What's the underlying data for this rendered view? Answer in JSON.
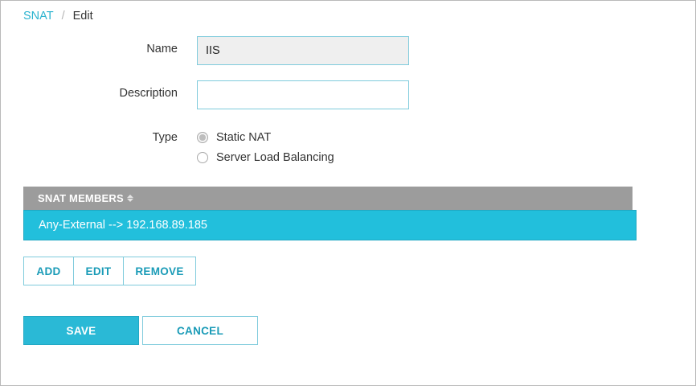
{
  "breadcrumb": {
    "parent": "SNAT",
    "separator": "/",
    "current": "Edit"
  },
  "form": {
    "name_label": "Name",
    "name_value": "IIS",
    "description_label": "Description",
    "description_value": "",
    "type_label": "Type",
    "type_options": [
      {
        "label": "Static NAT",
        "selected": true
      },
      {
        "label": "Server Load Balancing",
        "selected": false
      }
    ]
  },
  "members_table": {
    "header": "SNAT MEMBERS",
    "sort_icon": "sort-icon",
    "rows": [
      {
        "label": "Any-External --> 192.168.89.185",
        "selected": true
      }
    ]
  },
  "actions": {
    "add": "ADD",
    "edit": "EDIT",
    "remove": "REMOVE"
  },
  "footer": {
    "save": "SAVE",
    "cancel": "CANCEL"
  },
  "colors": {
    "accent": "#22bfdc",
    "link": "#2ab3cf",
    "header_bg": "#9c9c9c",
    "border": "#7fcbdc"
  }
}
